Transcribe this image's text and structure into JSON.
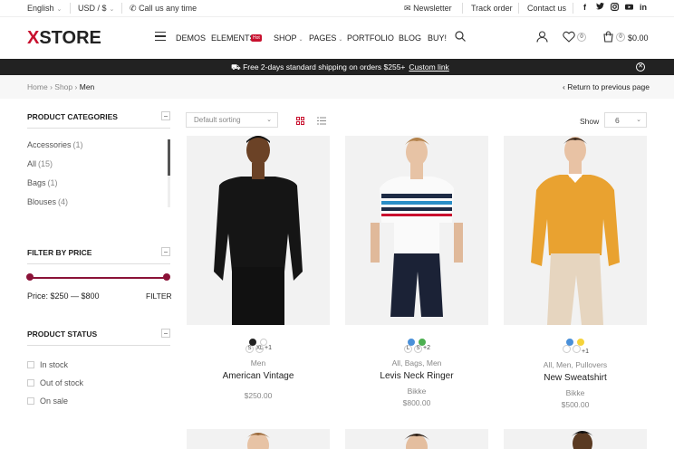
{
  "topbar": {
    "language": "English",
    "currency": "USD / $",
    "call_label": "Call us any time",
    "newsletter": "Newsletter",
    "track_order": "Track order",
    "contact_us": "Contact us",
    "social": [
      "f",
      "t",
      "ig",
      "yt",
      "in"
    ]
  },
  "header": {
    "logo_mark": "X",
    "logo_text": "STORE",
    "nav": [
      {
        "label": "Demos"
      },
      {
        "label": "Elements",
        "badge": "Hot"
      },
      {
        "label": "Shop"
      },
      {
        "label": "Pages"
      },
      {
        "label": "Portfolio"
      },
      {
        "label": "Blog"
      },
      {
        "label": "Buy!"
      }
    ],
    "wishlist_count": "0",
    "cart_count": "0",
    "cart_total": "$0.00"
  },
  "promo": {
    "text": "Free 2-days standard shipping on orders $255+",
    "link": "Custom link"
  },
  "breadcrumb": {
    "items": [
      "Home",
      "Shop"
    ],
    "current": "Men",
    "separator": "›",
    "back_label": "Return to previous page"
  },
  "sidebar": {
    "categories_title": "Product Categories",
    "categories": [
      {
        "label": "Accessories",
        "count": "(1)"
      },
      {
        "label": "All",
        "count": "(15)"
      },
      {
        "label": "Bags",
        "count": "(1)"
      },
      {
        "label": "Blouses",
        "count": "(4)"
      }
    ],
    "price_title": "Filter by Price",
    "price_label": "Price: $250 — $800",
    "filter_button": "Filter",
    "status_title": "Product Status",
    "status_options": [
      "In stock",
      "Out of stock",
      "On sale"
    ]
  },
  "toolbar": {
    "sort_value": "Default sorting",
    "show_label": "Show",
    "show_value": "6"
  },
  "products": [
    {
      "swatches": [
        "#222222",
        "#ffffff"
      ],
      "sizes": [
        "S",
        "XL"
      ],
      "more": "+1",
      "categories": "Men",
      "title": "American Vintage",
      "brand": "",
      "price": "$250.00"
    },
    {
      "swatches": [
        "#4a90d9",
        "#4caf50"
      ],
      "sizes": [
        "L",
        "S"
      ],
      "more": "+2",
      "categories": "All, Bags, Men",
      "title": "Levis Neck Ringer",
      "brand": "Bikke",
      "price": "$800.00"
    },
    {
      "swatches": [
        "#4a90d9",
        "#f5d33a"
      ],
      "sizes": [
        "",
        ""
      ],
      "more": "+1",
      "categories": "All, Men, Pullovers",
      "title": "New Sweatshirt",
      "brand": "Bikke",
      "price": "$500.00"
    }
  ],
  "colors": {
    "brand_red": "#c8102e",
    "range_accent": "#8b1238",
    "promo_bg": "#222222"
  }
}
